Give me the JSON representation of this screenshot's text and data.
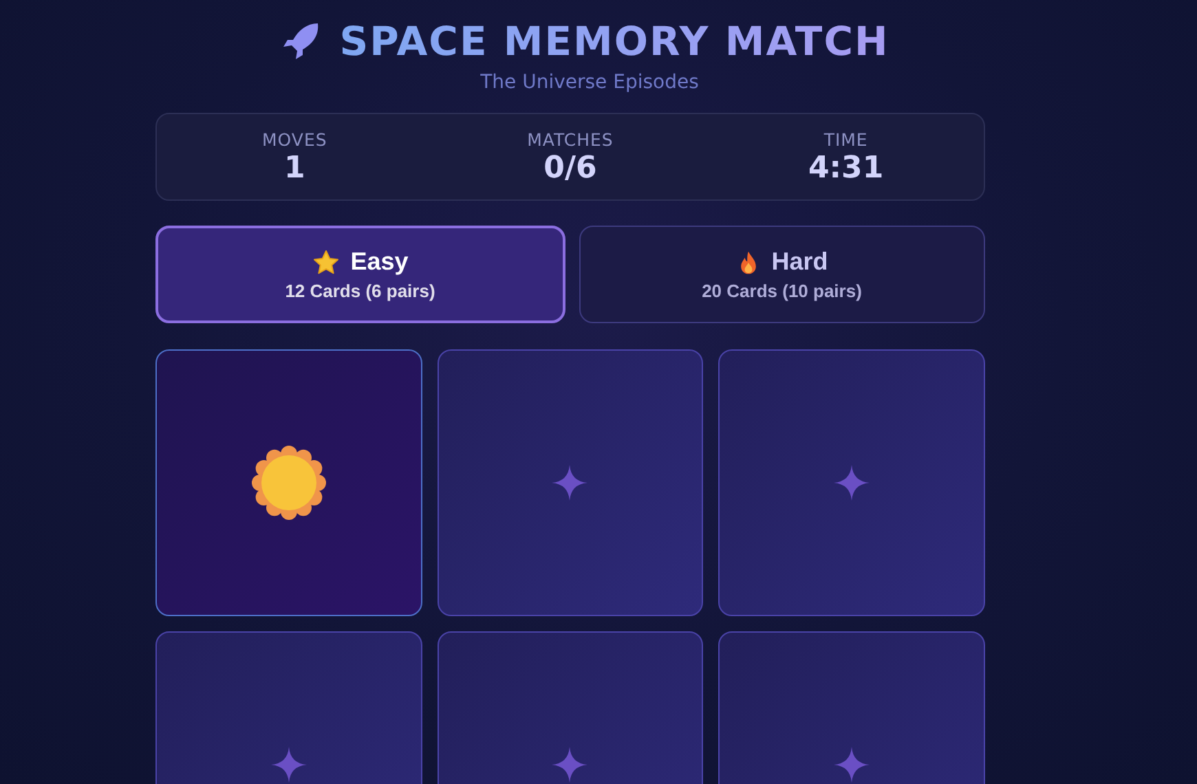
{
  "header": {
    "title": "SPACE MEMORY MATCH",
    "subtitle": "The Universe Episodes"
  },
  "stats": [
    {
      "label": "MOVES",
      "value": "1"
    },
    {
      "label": "MATCHES",
      "value": "0/6"
    },
    {
      "label": "TIME",
      "value": "4:31"
    }
  ],
  "difficulties": [
    {
      "kind": "star",
      "label": "Easy",
      "detail": "12 Cards (6 pairs)",
      "selected": true
    },
    {
      "kind": "flame",
      "label": "Hard",
      "detail": "20 Cards (10 pairs)",
      "selected": false
    }
  ],
  "cards": [
    {
      "flipped": true
    },
    {
      "flipped": false
    },
    {
      "flipped": false
    },
    {
      "flipped": false
    },
    {
      "flipped": false
    },
    {
      "flipped": false
    }
  ]
}
